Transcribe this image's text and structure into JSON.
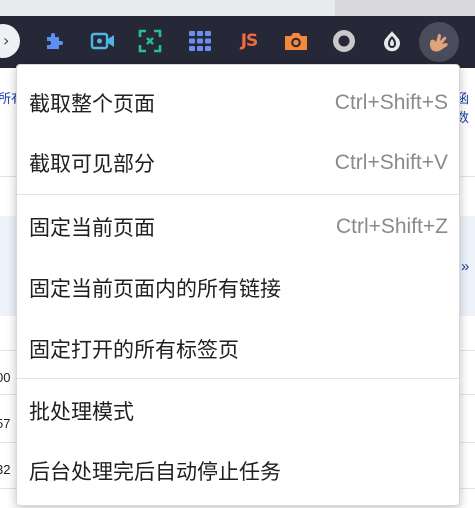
{
  "page_behind": {
    "left_fragment": "所有",
    "right_fragment": "函数",
    "more_chevron": "»",
    "row_numbers": [
      "00",
      "57",
      "32"
    ]
  },
  "toolbar": {
    "back_chevron": "›",
    "js_label": "JS",
    "extension_icons": [
      "puzzle-icon",
      "video-camera-icon",
      "screenshot-scan-icon",
      "grid-icon",
      "js-icon",
      "camera-icon",
      "record-circle-icon",
      "onion-icon",
      "hand-avatar-icon"
    ]
  },
  "menu": {
    "items": [
      {
        "label": "截取整个页面",
        "shortcut": "Ctrl+Shift+S"
      },
      {
        "label": "截取可见部分",
        "shortcut": "Ctrl+Shift+V"
      },
      {
        "label": "固定当前页面",
        "shortcut": "Ctrl+Shift+Z"
      },
      {
        "label": "固定当前页面内的所有链接",
        "shortcut": ""
      },
      {
        "label": "固定打开的所有标签页",
        "shortcut": ""
      },
      {
        "label": "批处理模式",
        "shortcut": ""
      },
      {
        "label": "后台处理完后自动停止任务",
        "shortcut": ""
      }
    ]
  }
}
